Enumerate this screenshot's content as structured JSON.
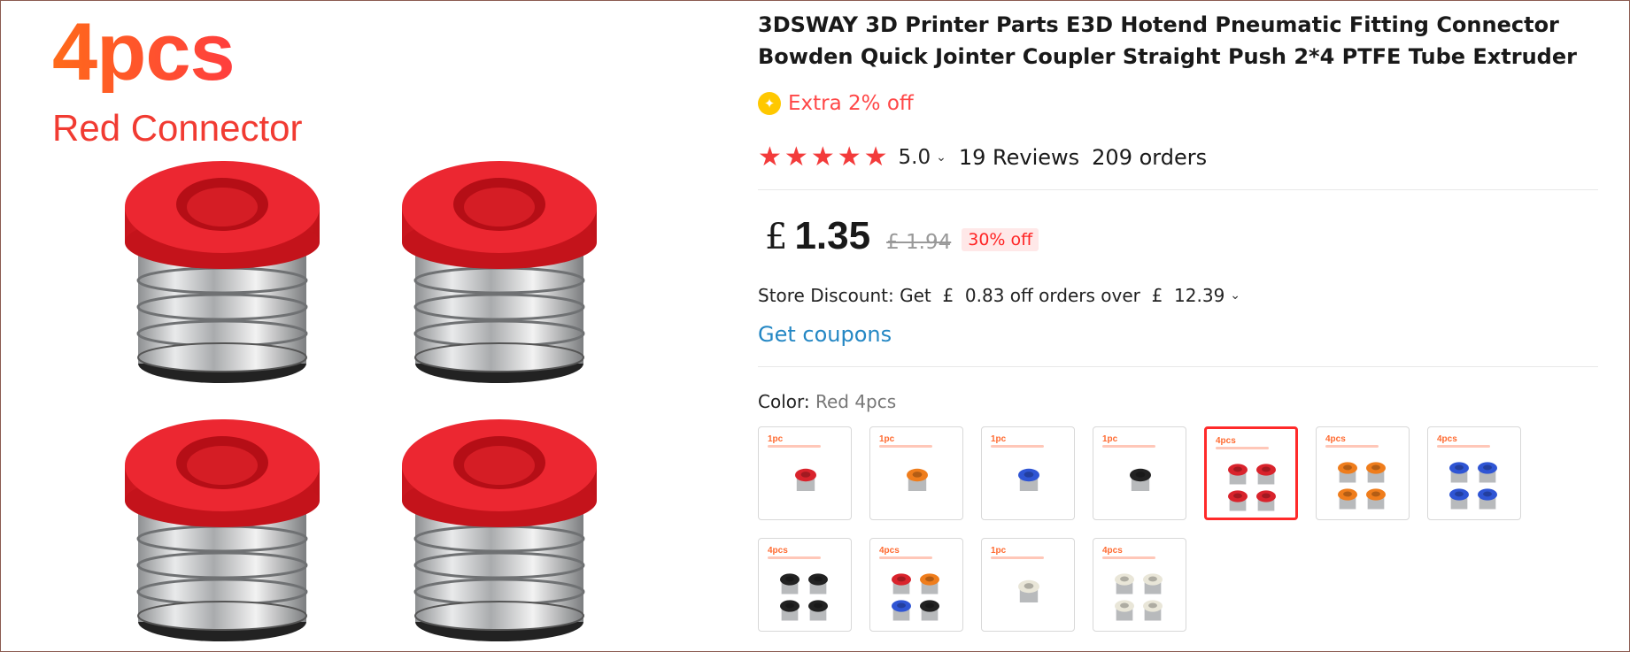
{
  "product_image": {
    "title": "4pcs",
    "subtitle": "Red Connector",
    "cap_color": "#e5252e"
  },
  "product": {
    "title": "3DSWAY 3D Printer Parts E3D Hotend Pneumatic Fitting Connector Bowden Quick Jointer Coupler Straight Push 2*4 PTFE Tube Extruder",
    "extra_discount": "Extra 2% off",
    "rating": "5.0",
    "rating_stars": 5,
    "reviews": "19 Reviews",
    "orders": "209 orders",
    "currency": "£",
    "price": "1.35",
    "old_price": "£ 1.94",
    "discount_badge": "30% off",
    "store_discount": "Store Discount: Get  £  0.83 off orders over  £  12.39",
    "get_coupons": "Get coupons",
    "color_label": "Color:",
    "color_value": "Red 4pcs"
  },
  "swatches": [
    {
      "label": "1pc",
      "colors": [
        "#d9232c"
      ],
      "count": 1,
      "selected": false
    },
    {
      "label": "1pc",
      "colors": [
        "#ef7d1c"
      ],
      "count": 1,
      "selected": false
    },
    {
      "label": "1pc",
      "colors": [
        "#2f55d4"
      ],
      "count": 1,
      "selected": false
    },
    {
      "label": "1pc",
      "colors": [
        "#222222"
      ],
      "count": 1,
      "selected": false
    },
    {
      "label": "4pcs",
      "colors": [
        "#d9232c",
        "#d9232c",
        "#d9232c",
        "#d9232c"
      ],
      "count": 4,
      "selected": true
    },
    {
      "label": "4pcs",
      "colors": [
        "#ef7d1c",
        "#ef7d1c",
        "#ef7d1c",
        "#ef7d1c"
      ],
      "count": 4,
      "selected": false
    },
    {
      "label": "4pcs",
      "colors": [
        "#2f55d4",
        "#2f55d4",
        "#2f55d4",
        "#2f55d4"
      ],
      "count": 4,
      "selected": false
    },
    {
      "label": "4pcs",
      "colors": [
        "#222222",
        "#222222",
        "#222222",
        "#222222"
      ],
      "count": 4,
      "selected": false
    },
    {
      "label": "4pcs",
      "colors": [
        "#d9232c",
        "#ef7d1c",
        "#2f55d4",
        "#222222"
      ],
      "count": 4,
      "selected": false
    },
    {
      "label": "1pc",
      "colors": [
        "#e9e6d8"
      ],
      "count": 1,
      "selected": false
    },
    {
      "label": "4pcs",
      "colors": [
        "#e9e6d8",
        "#e9e6d8",
        "#e9e6d8",
        "#e9e6d8"
      ],
      "count": 4,
      "selected": false
    }
  ],
  "icons": {
    "extra_badge": "sparkle-badge-icon",
    "star": "star-icon",
    "chevron": "chevron-down-icon"
  },
  "colors": {
    "accent_red": "#ff4747",
    "link_blue": "#2487c4",
    "star_red": "#f33b3b",
    "badge_yellow": "#ffc800"
  }
}
